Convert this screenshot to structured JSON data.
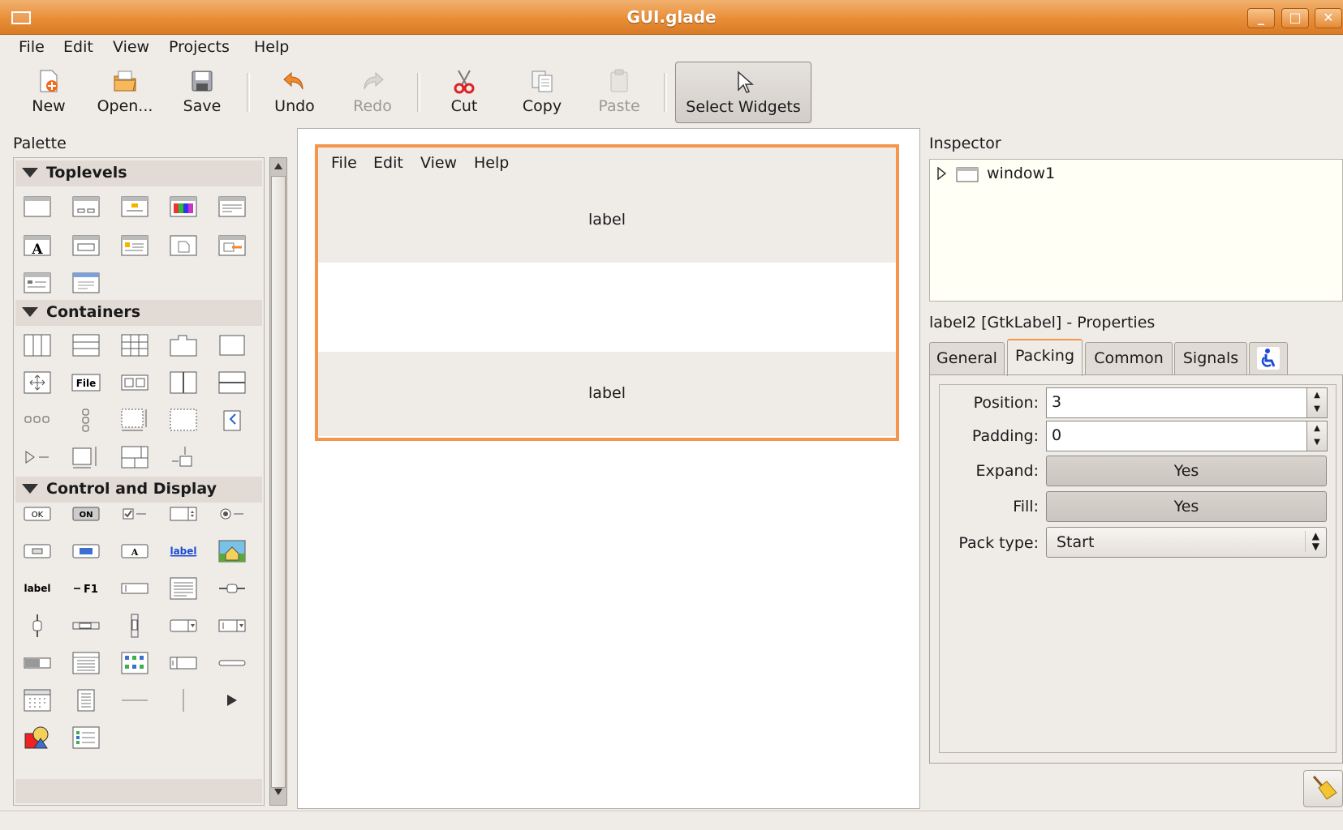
{
  "window": {
    "title": "GUI.glade",
    "minimize": "_",
    "maximize": "□",
    "close": "✕"
  },
  "menubar": [
    "File",
    "Edit",
    "View",
    "Projects",
    "Help"
  ],
  "toolbar": {
    "new": "New",
    "open": "Open...",
    "save": "Save",
    "undo": "Undo",
    "redo": "Redo",
    "cut": "Cut",
    "copy": "Copy",
    "paste": "Paste",
    "select_widgets": "Select Widgets"
  },
  "palette": {
    "title": "Palette",
    "groups": [
      "Toplevels",
      "Containers",
      "Control and Display"
    ],
    "icon_text": {
      "file": "File",
      "ok": "OK",
      "on": "ON",
      "label_link": "label",
      "label_bold": "label",
      "f1": "F1",
      "a": "A"
    }
  },
  "canvas": {
    "menu": [
      "File",
      "Edit",
      "View",
      "Help"
    ],
    "label_top": "label",
    "label_bottom": "label"
  },
  "inspector": {
    "title": "Inspector",
    "tree_item": "window1"
  },
  "properties": {
    "title": "label2 [GtkLabel] - Properties",
    "tabs": [
      "General",
      "Packing",
      "Common",
      "Signals"
    ],
    "active_tab": "Packing",
    "fields": {
      "position_label": "Position:",
      "position_value": "3",
      "padding_label": "Padding:",
      "padding_value": "0",
      "expand_label": "Expand:",
      "expand_value": "Yes",
      "fill_label": "Fill:",
      "fill_value": "Yes",
      "pack_type_label": "Pack type:",
      "pack_type_value": "Start"
    }
  },
  "colors": {
    "titlebar": "#e98e37",
    "selection": "#f4964b",
    "background": "#efebe7"
  }
}
